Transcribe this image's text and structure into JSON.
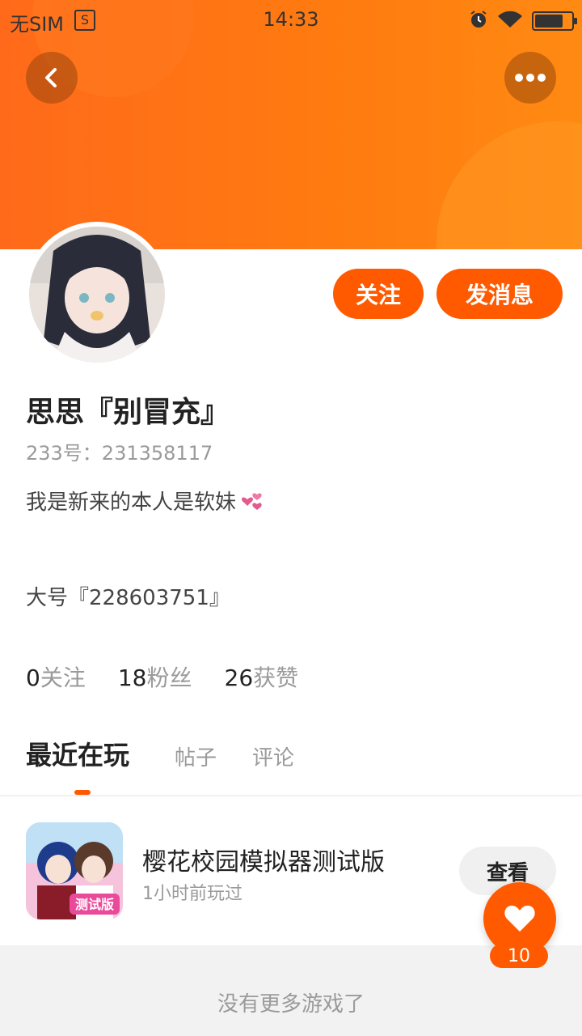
{
  "status_bar": {
    "carrier": "无SIM",
    "time": "14:33",
    "icons": [
      "sim-icon",
      "alarm-icon",
      "wifi-icon",
      "battery-charging-icon"
    ]
  },
  "header": {
    "back_icon": "chevron-left-icon",
    "more_icon": "more-horizontal-icon",
    "accent_color": "#ff6a1a"
  },
  "profile": {
    "name": "思思『别冒充』",
    "id_line": "233号：231358117",
    "bio_line1": "我是新来的本人是软妹",
    "bio_line1_icon": "hearts-icon",
    "bio_line2": "大号『228603751』"
  },
  "actions": {
    "follow_label": "关注",
    "message_label": "发消息",
    "button_color": "#ff5a00"
  },
  "stats": [
    {
      "num": "0",
      "label": "关注"
    },
    {
      "num": "18",
      "label": "粉丝"
    },
    {
      "num": "26",
      "label": "获赞"
    }
  ],
  "tabs": [
    {
      "label": "最近在玩",
      "active": true
    },
    {
      "label": "帖子",
      "active": false
    },
    {
      "label": "评论",
      "active": false
    }
  ],
  "games": [
    {
      "title": "樱花校园模拟器测试版",
      "subtitle": "1小时前玩过",
      "button": "查看",
      "icon_label": "测试版"
    }
  ],
  "footer": {
    "text": "没有更多游戏了"
  },
  "like": {
    "count": "10",
    "icon": "heart-icon"
  }
}
